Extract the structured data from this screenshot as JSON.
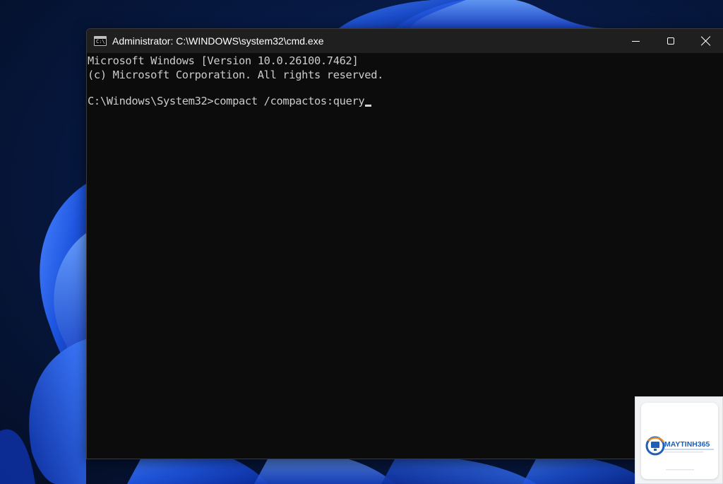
{
  "window": {
    "title": "Administrator: C:\\WINDOWS\\system32\\cmd.exe",
    "icon": "cmd-icon",
    "icon_prompt_text": "C:\\",
    "controls": {
      "minimize": "minimize-icon",
      "maximize": "maximize-icon",
      "close": "close-icon"
    }
  },
  "console": {
    "lines": [
      "Microsoft Windows [Version 10.0.26100.7462]",
      "(c) Microsoft Corporation. All rights reserved."
    ],
    "prompt": "C:\\Windows\\System32>",
    "command": "compact /compactos:query"
  },
  "watermark": {
    "brand": "MAYTINH365",
    "brand_colors": {
      "blue": "#1f5fb8",
      "orange": "#f08a1c"
    }
  },
  "colors": {
    "console_bg": "#0c0c0c",
    "console_text": "#cccccc",
    "titlebar_bg": "#1f1f1f",
    "desktop_bg": "#061634"
  }
}
